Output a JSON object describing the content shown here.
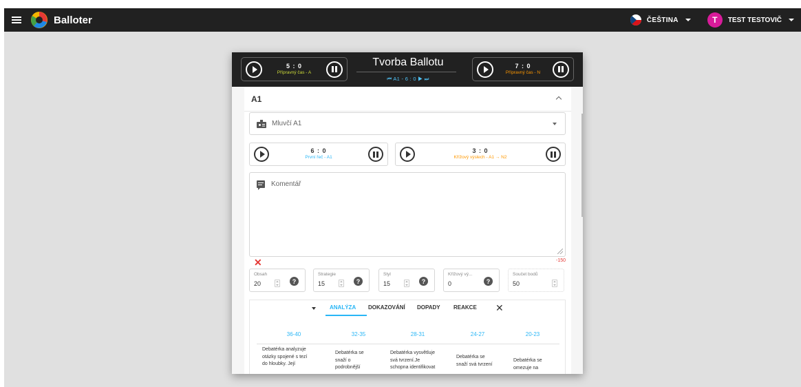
{
  "topbar": {
    "app_name": "Balloter",
    "language": "ČEŠTINA",
    "user_initial": "T",
    "user_name": "TEST TESTOVIČ"
  },
  "dialog": {
    "title": "Tvorba Ballotu",
    "nav_prev": "⏮",
    "nav_text": "A1 - 6 : 0",
    "nav_play": "▶",
    "nav_next": "⏭",
    "left_timer": {
      "value": "5 : 0",
      "label": "Přípravný čas - A"
    },
    "right_timer": {
      "value": "7 : 0",
      "label": "Přípravný čas - N"
    }
  },
  "section": {
    "title": "A1",
    "speaker_placeholder": "Mluvčí A1",
    "timer_a": {
      "value": "6 : 0",
      "label": "První řeč - A1"
    },
    "timer_b": {
      "value": "3 : 0",
      "label": "Křížový výslech - A1 → N2"
    },
    "comment_label": "Komentář",
    "char_count": "-150",
    "clear_symbol": "✕"
  },
  "scores": [
    {
      "label": "Obsah",
      "value": "20"
    },
    {
      "label": "Strategie",
      "value": "15"
    },
    {
      "label": "Styl",
      "value": "15"
    },
    {
      "label": "Křížový vý...",
      "value": "0"
    },
    {
      "label": "Součet bodů",
      "value": "50"
    }
  ],
  "tabs": {
    "items": [
      "ANALÝZA",
      "DOKAZOVÁNÍ",
      "DOPADY",
      "REAKCE"
    ],
    "active": "ANALÝZA",
    "close_symbol": "✕"
  },
  "rubric": {
    "ranges": [
      "36-40",
      "32-35",
      "28-31",
      "24-27",
      "20-23"
    ],
    "texts": [
      [
        "Debatérka analyzuje",
        "otázky spojené s tezí",
        "do hloubky. Její"
      ],
      [
        "Debatérka se",
        "snaží o",
        "podrobnější"
      ],
      [
        "Debatérka vysvětluje",
        "svá tvrzení.Je",
        "schopna identifikovat"
      ],
      [
        "Debatérka se",
        "snaží svá tvrzení"
      ],
      [
        "Debatérka se",
        "omezuje na"
      ]
    ]
  },
  "colors": {
    "topbar": "#212121",
    "accent": "#29b6f6",
    "timer_label_left": "#cddc39",
    "timer_label_right": "#ff9800",
    "sub_timer_label_a": "#29b6f6",
    "sub_timer_label_b": "#ff9800",
    "error": "#e53935",
    "avatar": "#d81b9a"
  }
}
